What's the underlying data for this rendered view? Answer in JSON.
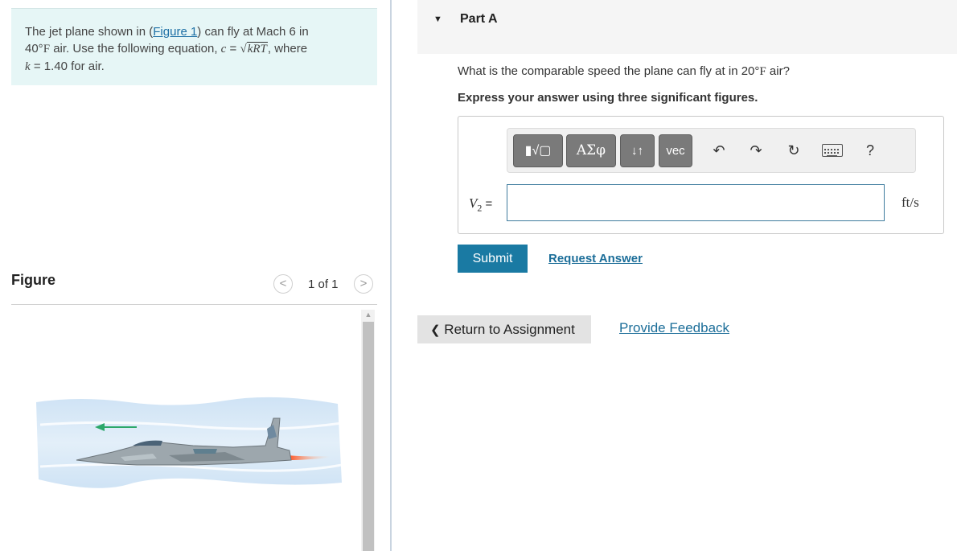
{
  "problem": {
    "text_before_link": "The jet plane shown in (",
    "link_text": "Figure 1",
    "text_after_link": ") can fly at Mach 6 in",
    "temp_value": "40°",
    "temp_unit": "F",
    "line2_text": " air. Use the following equation, ",
    "eq_c": "c",
    "eq_equals": " = ",
    "eq_radicand": "kRT",
    "eq_after": ", where",
    "k_var": "k",
    "k_text": " = 1.40 for air."
  },
  "figure": {
    "header": "Figure",
    "counter": "1 of 1",
    "prev_glyph": "<",
    "next_glyph": ">"
  },
  "part": {
    "toggle_glyph": "▼",
    "title": "Part A",
    "question_before": "What is the comparable speed the plane can fly at in 20°",
    "question_unit": "F",
    "question_after": " air?",
    "instruction": "Express your answer using three significant figures."
  },
  "toolbar": {
    "templates": "▮√▢",
    "greek": "ΑΣφ",
    "arrows": "↓↑",
    "vec": "vec",
    "undo": "↶",
    "redo": "↷",
    "reset": "↻",
    "help": "?"
  },
  "answer": {
    "var_main": "V",
    "var_sub": "2",
    "equals": " =",
    "value": "",
    "unit": "ft/s"
  },
  "actions": {
    "submit": "Submit",
    "request_answer": "Request Answer",
    "return_glyph": "❮",
    "return_label": " Return to Assignment",
    "provide_feedback": "Provide Feedback"
  },
  "colors": {
    "problem_bg": "#e6f6f6",
    "accent": "#1a7aa3",
    "link": "#1c6e99",
    "arrow_green": "#2ca86a",
    "exhaust": "#ff6a2b"
  }
}
